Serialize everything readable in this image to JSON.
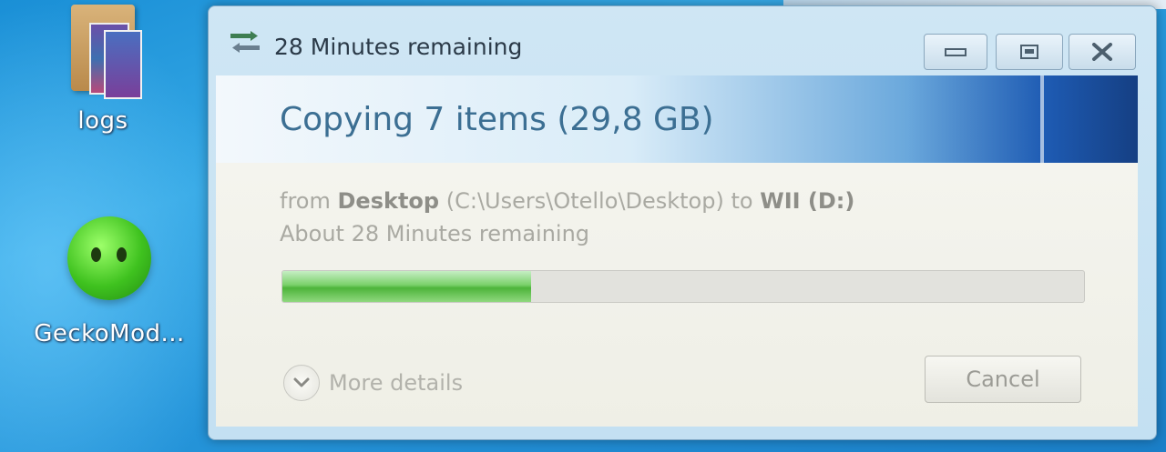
{
  "desktop": {
    "icons": [
      {
        "label": "logs"
      },
      {
        "label": "GeckoMod..."
      }
    ]
  },
  "dialog": {
    "window_title": "28 Minutes remaining",
    "heading": "Copying 7 items (29,8 GB)",
    "from_prefix": "from",
    "source_name": "Desktop",
    "source_path": "(C:\\Users\\Otello\\Desktop)",
    "to_word": "to",
    "destination": "WII (D:)",
    "time_remaining": "About 28 Minutes remaining",
    "progress_fraction": 0.31,
    "more_details_label": "More details",
    "cancel_label": "Cancel"
  },
  "colors": {
    "progress_fill": "#4db43a",
    "banner_dark": "#153f83"
  }
}
